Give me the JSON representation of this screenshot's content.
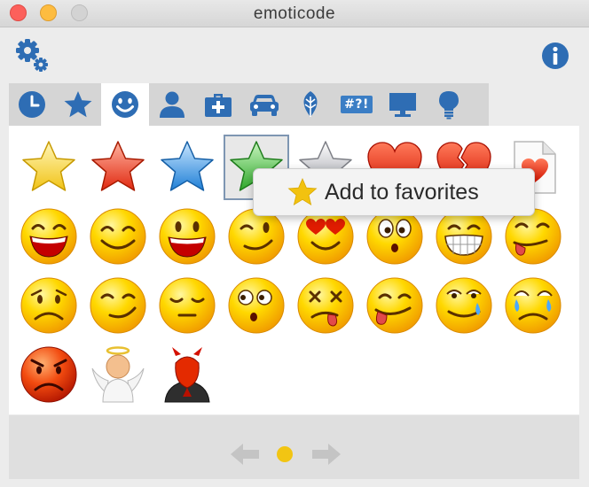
{
  "window": {
    "title": "emoticode"
  },
  "toolbar": {
    "settings_icon": "gear-icon",
    "info_icon": "info-icon"
  },
  "tabs": [
    {
      "icon": "clock-icon",
      "label": ""
    },
    {
      "icon": "star-icon",
      "label": ""
    },
    {
      "icon": "smiley-icon",
      "label": "",
      "active": true
    },
    {
      "icon": "person-icon",
      "label": ""
    },
    {
      "icon": "medkit-icon",
      "label": ""
    },
    {
      "icon": "car-icon",
      "label": ""
    },
    {
      "icon": "leaf-icon",
      "label": ""
    },
    {
      "icon": "symbols-icon",
      "label": "#?!"
    },
    {
      "icon": "monitor-icon",
      "label": ""
    },
    {
      "icon": "bulb-icon",
      "label": ""
    }
  ],
  "emoticons": [
    "yellow-star",
    "red-star",
    "blue-star",
    "green-star",
    "grey-star",
    "red-heart",
    "broken-heart",
    "heart-letter",
    "laughing-smiley",
    "happy-smiley",
    "grin-smiley",
    "winking-smiley",
    "heart-eyes-smiley",
    "surprised-smiley",
    "big-teeth-smiley",
    "tongue-wink-smiley",
    "sad-smiley",
    "smug-smiley",
    "sleepy-smiley",
    "shocked-smiley",
    "dizzy-smiley",
    "tongue-smiley",
    "crying-laugh-smiley",
    "crying-smiley",
    "angry-smiley",
    "angel",
    "devil"
  ],
  "selected_index": 3,
  "tooltip": {
    "label": "Add to favorites",
    "icon": "star-icon",
    "color": "#f2c20f"
  },
  "pager": {
    "current_page": 1,
    "total_pages": 1
  },
  "colors": {
    "accent": "#3b7ec5",
    "tab_bar": "#d5d5d5",
    "pager_dot": "#f2c513"
  }
}
